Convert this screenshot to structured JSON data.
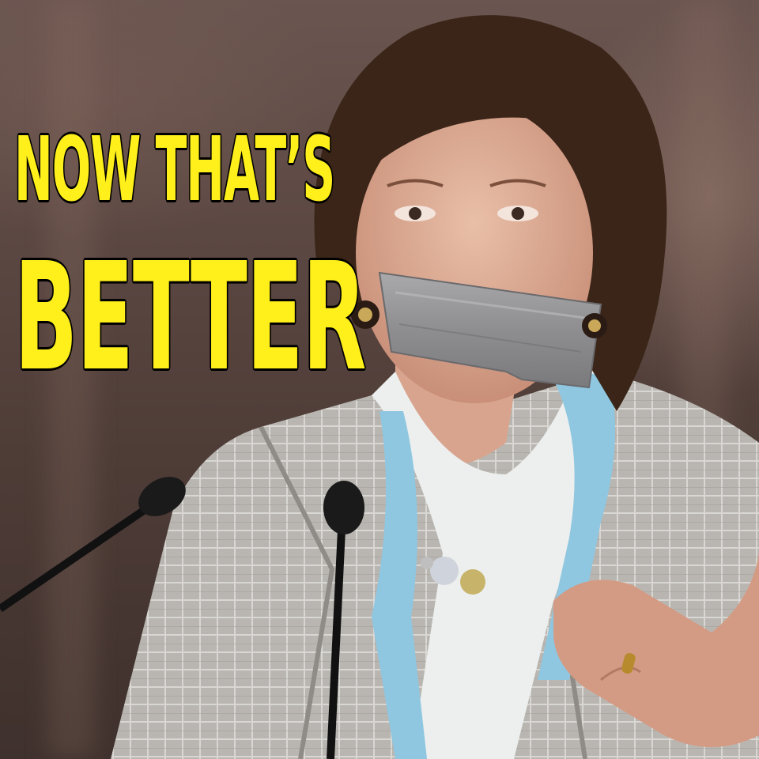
{
  "meme": {
    "caption_line1": "NOW THAT’S",
    "caption_line2": "BETTER",
    "caption_color": "#ffef1a",
    "caption_outline_color": "#000000"
  }
}
